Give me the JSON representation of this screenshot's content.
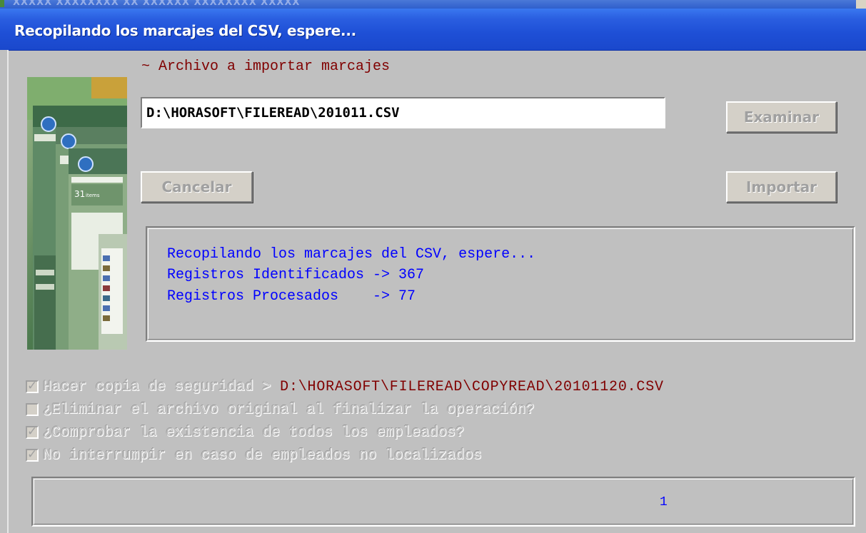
{
  "window": {
    "title": "Recopilando los marcajes del CSV, espere...",
    "behind_title": "XXXXX XXXXXXXX XX XXXXXX XXXXXXXX XXXXX"
  },
  "import": {
    "label": "~ Archivo a importar marcajes",
    "file_path": "D:\\HORASOFT\\FILEREAD\\201011.CSV"
  },
  "buttons": {
    "examinar": "Examinar",
    "cancelar": "Cancelar",
    "importar": "Importar"
  },
  "status": {
    "line1": "Recopilando los marcajes del CSV, espere...",
    "line2": "Registros Identificados -> 367",
    "line3": "Registros Procesados    -> 77"
  },
  "options": {
    "backup_label": "Hacer copia de seguridad > ",
    "backup_path": "D:\\HORASOFT\\FILEREAD\\COPYREAD\\20101120.CSV",
    "backup_checked": true,
    "delete_original_label": "¿Eliminar el archivo original al finalizar la operación?",
    "delete_original_checked": false,
    "check_employees_label": "¿Comprobar la existencia de todos los empleados?",
    "check_employees_checked": true,
    "no_interrupt_label": "No interrumpir en caso de empleados no localizados",
    "no_interrupt_checked": true
  },
  "progress": {
    "counter": "1"
  },
  "colors": {
    "titlebar": "#1e4fd6",
    "face": "#c0c0c0",
    "status_text": "#0000ff",
    "path_text": "#800000"
  }
}
